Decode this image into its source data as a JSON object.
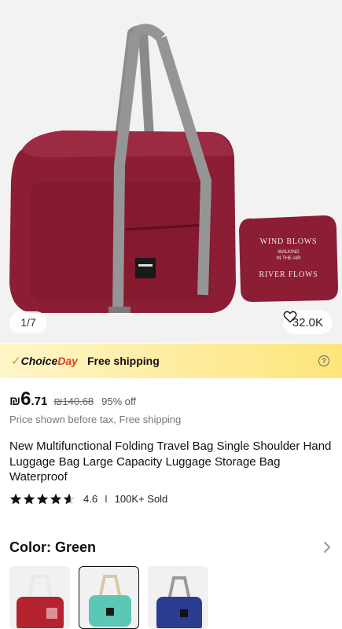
{
  "gallery": {
    "counter": "1/7",
    "likes": "32.0K",
    "pouch_text_top": "WIND BLOWS",
    "pouch_text_mid_1": "WALKING",
    "pouch_text_mid_2": "IN THE AIR",
    "pouch_text_bottom": "RIVER FLOWS"
  },
  "promo": {
    "choice_label": "Choice",
    "day_label": "Day",
    "shipping": "Free shipping",
    "help_icon": "?"
  },
  "price": {
    "currency": "₪",
    "integer": "6",
    "decimal": ".71",
    "original": "₪140.68",
    "discount": "95% off",
    "tax_note": "Price shown before tax, Free shipping"
  },
  "product": {
    "title": "New Multifunctional Folding Travel Bag Single Shoulder Hand Luggage Bag Large Capacity Luggage Storage Bag Waterproof",
    "rating_value": "4.6",
    "rating_stars": 4.6,
    "sold": "100K+ Sold"
  },
  "variant": {
    "label": "Color: Green",
    "options": [
      {
        "name": "red",
        "color": "#b5232f"
      },
      {
        "name": "green",
        "color": "#5cc7b4",
        "selected": true
      },
      {
        "name": "blue",
        "color": "#2c3d8f"
      }
    ]
  },
  "colors": {
    "bag_main": "#8b1e35",
    "strap": "#8f8f8f",
    "accent_red": "#e23b23",
    "promo_yellow": "#fde57a"
  }
}
